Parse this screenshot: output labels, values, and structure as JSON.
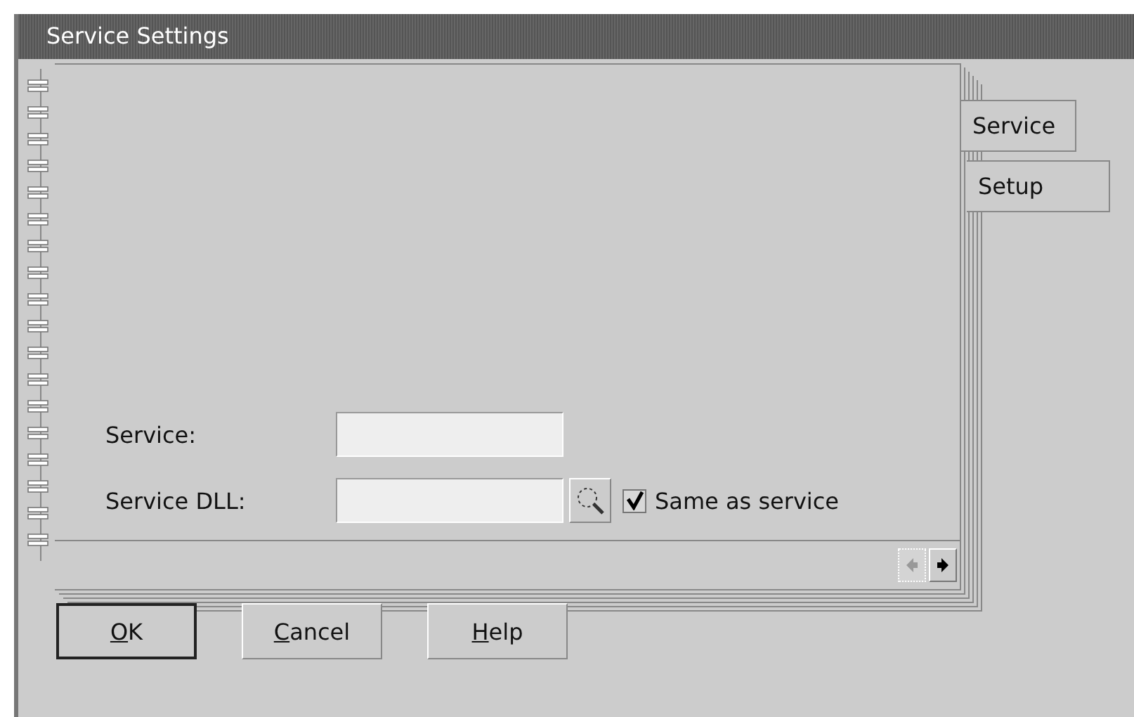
{
  "window": {
    "title": "Service Settings"
  },
  "tabs": [
    {
      "label": "Service",
      "selected": true
    },
    {
      "label": "Setup",
      "selected": false
    }
  ],
  "form": {
    "service_label": "Service:",
    "dll_label": "Service DLL:",
    "same_as_service": {
      "label": "Same as service",
      "checked": true
    }
  },
  "page_buttons": [
    {
      "disabled": true
    },
    {
      "disabled": false
    }
  ],
  "buttons": [
    {
      "label": "OK",
      "default": true
    },
    {
      "label": "Cancel",
      "default": false
    },
    {
      "label": "Help",
      "default": false
    }
  ]
}
